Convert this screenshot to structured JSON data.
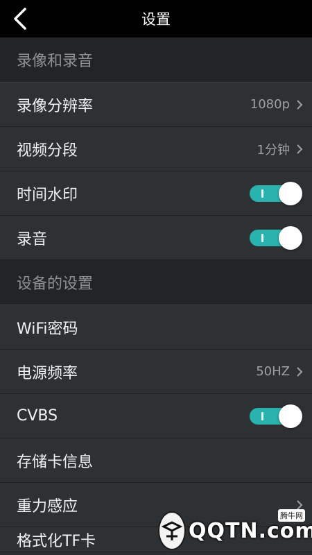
{
  "header": {
    "title": "设置",
    "back_icon": "back-arrow-icon"
  },
  "sections": {
    "recording": "录像和录音",
    "device": "设备的设置"
  },
  "rows": {
    "resolution": {
      "label": "录像分辨率",
      "value": "1080p"
    },
    "segment": {
      "label": "视频分段",
      "value": "1分钟"
    },
    "timestamp": {
      "label": "时间水印",
      "toggle": true
    },
    "audio": {
      "label": "录音",
      "toggle": true
    },
    "wifi": {
      "label": "WiFi密码"
    },
    "power_freq": {
      "label": "电源频率",
      "value": "50HZ"
    },
    "cvbs": {
      "label": "CVBS",
      "toggle": true
    },
    "storage": {
      "label": "存储卡信息"
    },
    "gsensor": {
      "label": "重力感应"
    },
    "format": {
      "label": "格式化TF卡"
    }
  },
  "watermark": {
    "text": "QQTN.com",
    "badge": "腾牛网"
  },
  "colors": {
    "toggle_on": "#2ab3ae",
    "background": "#2e3133",
    "section_bg": "#222426"
  }
}
